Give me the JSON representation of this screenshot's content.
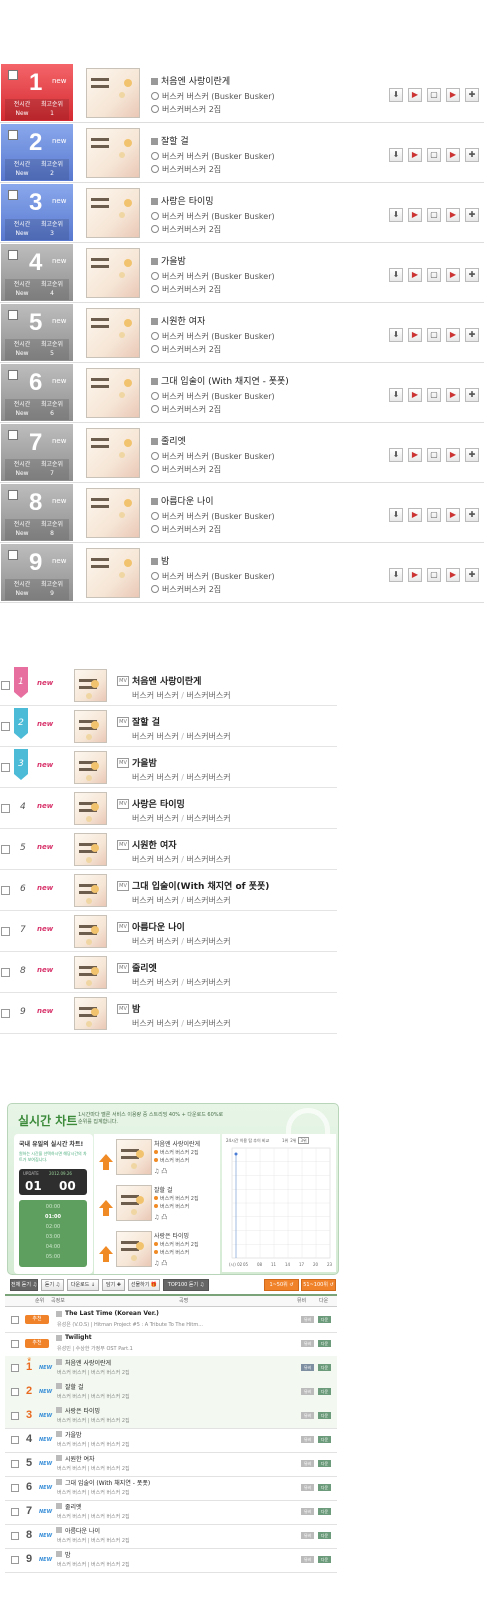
{
  "section1": {
    "rows": [
      {
        "rank": "1",
        "new": "new",
        "style": "red",
        "title": "처음엔 사랑이란게",
        "artist": "버스커 버스커 (Busker Busker)",
        "album": "버스커버스커 2집",
        "stat": {
          "l1": "전시간",
          "l2": "New",
          "r1": "최고순위",
          "r2": "1"
        }
      },
      {
        "rank": "2",
        "new": "new",
        "style": "blue",
        "title": "잘할 걸",
        "artist": "버스커 버스커 (Busker Busker)",
        "album": "버스커버스커 2집",
        "stat": {
          "l1": "전시간",
          "l2": "New",
          "r1": "최고순위",
          "r2": "2"
        }
      },
      {
        "rank": "3",
        "new": "new",
        "style": "blue",
        "title": "사랑은 타이밍",
        "artist": "버스커 버스커 (Busker Busker)",
        "album": "버스커버스커 2집",
        "stat": {
          "l1": "전시간",
          "l2": "New",
          "r1": "최고순위",
          "r2": "3"
        }
      },
      {
        "rank": "4",
        "new": "new",
        "style": "gray",
        "title": "가을밤",
        "artist": "버스커 버스커 (Busker Busker)",
        "album": "버스커버스커 2집",
        "stat": {
          "l1": "전시간",
          "l2": "New",
          "r1": "최고순위",
          "r2": "4"
        }
      },
      {
        "rank": "5",
        "new": "new",
        "style": "gray",
        "title": "시원한 여자",
        "artist": "버스커 버스커 (Busker Busker)",
        "album": "버스커버스커 2집",
        "stat": {
          "l1": "전시간",
          "l2": "New",
          "r1": "최고순위",
          "r2": "5"
        }
      },
      {
        "rank": "6",
        "new": "new",
        "style": "gray",
        "title": "그대 입술이 (With 채지연 - 폿폿)",
        "artist": "버스커 버스커 (Busker Busker)",
        "album": "버스커버스커 2집",
        "stat": {
          "l1": "전시간",
          "l2": "New",
          "r1": "최고순위",
          "r2": "6"
        }
      },
      {
        "rank": "7",
        "new": "new",
        "style": "gray",
        "title": "줄리엣",
        "artist": "버스커 버스커 (Busker Busker)",
        "album": "버스커버스커 2집",
        "stat": {
          "l1": "전시간",
          "l2": "New",
          "r1": "최고순위",
          "r2": "7"
        }
      },
      {
        "rank": "8",
        "new": "new",
        "style": "gray",
        "title": "아름다운 나이",
        "artist": "버스커 버스커 (Busker Busker)",
        "album": "버스커버스커 2집",
        "stat": {
          "l1": "전시간",
          "l2": "New",
          "r1": "최고순위",
          "r2": "8"
        }
      },
      {
        "rank": "9",
        "new": "new",
        "style": "gray",
        "title": "밤",
        "artist": "버스커 버스커 (Busker Busker)",
        "album": "버스커버스커 2집",
        "stat": {
          "l1": "전시간",
          "l2": "New",
          "r1": "최고순위",
          "r2": "9"
        }
      }
    ],
    "row_icons": [
      "download-icon",
      "play-icon",
      "video-icon",
      "add-to-playlist-icon",
      "plus-icon"
    ],
    "row_icon_glyphs": [
      "⬇",
      "▶",
      "▢",
      "▶",
      "✚"
    ],
    "colors": {
      "red": "#d42a31",
      "blue": "#5878cf",
      "gray": "#8f8f8f"
    }
  },
  "section2": {
    "rows": [
      {
        "rank": "1",
        "new": "new",
        "flag": "pink",
        "mv": "MV",
        "title": "처음엔 사랑이란게",
        "artist": "버스커 버스커",
        "album": "버스커버스커"
      },
      {
        "rank": "2",
        "new": "new",
        "flag": "cyan",
        "mv": "MV",
        "title": "잘할 걸",
        "artist": "버스커 버스커",
        "album": "버스커버스커"
      },
      {
        "rank": "3",
        "new": "new",
        "flag": "cyan",
        "mv": "MV",
        "title": "가을밤",
        "artist": "버스커 버스커",
        "album": "버스커버스커"
      },
      {
        "rank": "4",
        "new": "new",
        "flag": "",
        "mv": "MV",
        "title": "사랑은 타이밍",
        "artist": "버스커 버스커",
        "album": "버스커버스커"
      },
      {
        "rank": "5",
        "new": "new",
        "flag": "",
        "mv": "MV",
        "title": "시원한 여자",
        "artist": "버스커 버스커",
        "album": "버스커버스커"
      },
      {
        "rank": "6",
        "new": "new",
        "flag": "",
        "mv": "MV",
        "title": "그대 입술이(With 채지연 of 폿폿)",
        "artist": "버스커 버스커",
        "album": "버스커버스커"
      },
      {
        "rank": "7",
        "new": "new",
        "flag": "",
        "mv": "MV",
        "title": "아름다운 나이",
        "artist": "버스커 버스커",
        "album": "버스커버스커"
      },
      {
        "rank": "8",
        "new": "new",
        "flag": "",
        "mv": "MV",
        "title": "줄리엣",
        "artist": "버스커 버스커",
        "album": "버스커버스커"
      },
      {
        "rank": "9",
        "new": "new",
        "flag": "",
        "mv": "MV",
        "title": "밤",
        "artist": "버스커 버스커",
        "album": "버스커버스커"
      }
    ],
    "separator": "/"
  },
  "section3": {
    "title": "실시간 차트",
    "note": "1시간마다 멜론 서비스 이용량 중 스트리밍 40% + 다운로드 60%로 순위를 집계합니다.",
    "panel": {
      "heading": "국내 유일의 실시간 차트!",
      "sub": "원하는 시간을 선택하시면 해당시간의 차트가 보여집니다.",
      "update": "UPDATE",
      "date": "2012.09.26",
      "hour": "01",
      "minute": "00",
      "timeline": [
        "00:00",
        "01:00",
        "02:00",
        "03:00",
        "04:00",
        "05:00"
      ],
      "selected": "01:00"
    },
    "top3": [
      {
        "title": "처음엔 사랑이란게",
        "artist": "버스커 버스커 2집",
        "album": "버스커 버스커",
        "icons": "♫ 凸"
      },
      {
        "title": "잘할 걸",
        "artist": "버스커 버스커 2집",
        "album": "버스커 버스커",
        "icons": "♫ 凸"
      },
      {
        "title": "사랑은 타이밍",
        "artist": "버스커 버스커 2집",
        "album": "버스커 버스커",
        "icons": "♫ 凸"
      }
    ],
    "chart": {
      "caption": "24시간 이용 탑 추이 비교",
      "legend": [
        "1위",
        "2위",
        "3위"
      ],
      "legend_selected": "3위",
      "xticks": [
        "(시) 02",
        "05",
        "08",
        "11",
        "14",
        "17",
        "20",
        "23"
      ]
    },
    "chart_data": {
      "type": "line",
      "x": [
        2,
        5,
        8,
        11,
        14,
        17,
        20,
        23
      ],
      "series": [
        {
          "name": "1위",
          "values": [
            1,
            null,
            null,
            null,
            null,
            null,
            null,
            null
          ]
        }
      ],
      "xlabel": "(시)",
      "ylabel": "",
      "grid": true,
      "title": "24시간 이용 탑 추이 비교"
    },
    "toolbar": {
      "buttons": [
        "전체 듣기 ♫",
        "듣기 ♫",
        "다운로드 ↓",
        "담기 ✚",
        "선물하기 🎁",
        "TOP100 듣기 ♫"
      ],
      "pages": [
        "1~50위 ↺",
        "51~100위 ↺"
      ]
    },
    "table_headers": [
      "순위",
      "곡정보",
      "곡명",
      "뮤비",
      "다운"
    ],
    "rows": [
      {
        "rank": "추천",
        "type": "badge",
        "title": "The Last Time (Korean Ver.)",
        "sub": "유성은 (V.O.S) | Hitman Project #5 : A Tribute To The Hitm...",
        "b1": "뮤비",
        "b2": "다운",
        "hl": false
      },
      {
        "rank": "추천",
        "type": "badge",
        "title": "Twilight",
        "sub": "유성민 | 수상한 가정부 OST Part.1",
        "b1": "뮤비",
        "b2": "다운",
        "hl": false
      },
      {
        "rank": "1",
        "type": "orange",
        "crown": "♛",
        "new": "NEW",
        "title": "처음엔 사랑이란게",
        "sub": "버스커 버스커 | 버스커 버스커 2집",
        "b1": "뮤비",
        "b2": "다운",
        "hl": true
      },
      {
        "rank": "2",
        "type": "orange",
        "new": "NEW",
        "title": "잘할 걸",
        "sub": "버스커 버스커 | 버스커 버스커 2집",
        "b1": "뮤비",
        "b2": "다운",
        "hl": true
      },
      {
        "rank": "3",
        "type": "orange",
        "new": "NEW",
        "title": "사랑은 타이밍",
        "sub": "버스커 버스커 | 버스커 버스커 2집",
        "b1": "뮤비",
        "b2": "다운",
        "hl": true
      },
      {
        "rank": "4",
        "type": "gray",
        "new": "NEW",
        "title": "가을밤",
        "sub": "버스커 버스커 | 버스커 버스커 2집",
        "b1": "뮤비",
        "b2": "다운",
        "hl": false
      },
      {
        "rank": "5",
        "type": "gray",
        "new": "NEW",
        "title": "시원한 여자",
        "sub": "버스커 버스커 | 버스커 버스커 2집",
        "b1": "뮤비",
        "b2": "다운",
        "hl": false
      },
      {
        "rank": "6",
        "type": "gray",
        "new": "NEW",
        "title": "그대 입술이 (With 채지연 - 폿폿)",
        "sub": "버스커 버스커 | 버스커 버스커 2집",
        "b1": "뮤비",
        "b2": "다운",
        "hl": false
      },
      {
        "rank": "7",
        "type": "gray",
        "new": "NEW",
        "title": "줄리엣",
        "sub": "버스커 버스커 | 버스커 버스커 2집",
        "b1": "뮤비",
        "b2": "다운",
        "hl": false
      },
      {
        "rank": "8",
        "type": "gray",
        "new": "NEW",
        "title": "아름다운 나이",
        "sub": "버스커 버스커 | 버스커 버스커 2집",
        "b1": "뮤비",
        "b2": "다운",
        "hl": false
      },
      {
        "rank": "9",
        "type": "gray",
        "new": "NEW",
        "title": "밤",
        "sub": "버스커 버스커 | 버스커 버스커 2집",
        "b1": "뮤비",
        "b2": "다운",
        "hl": false
      }
    ]
  }
}
